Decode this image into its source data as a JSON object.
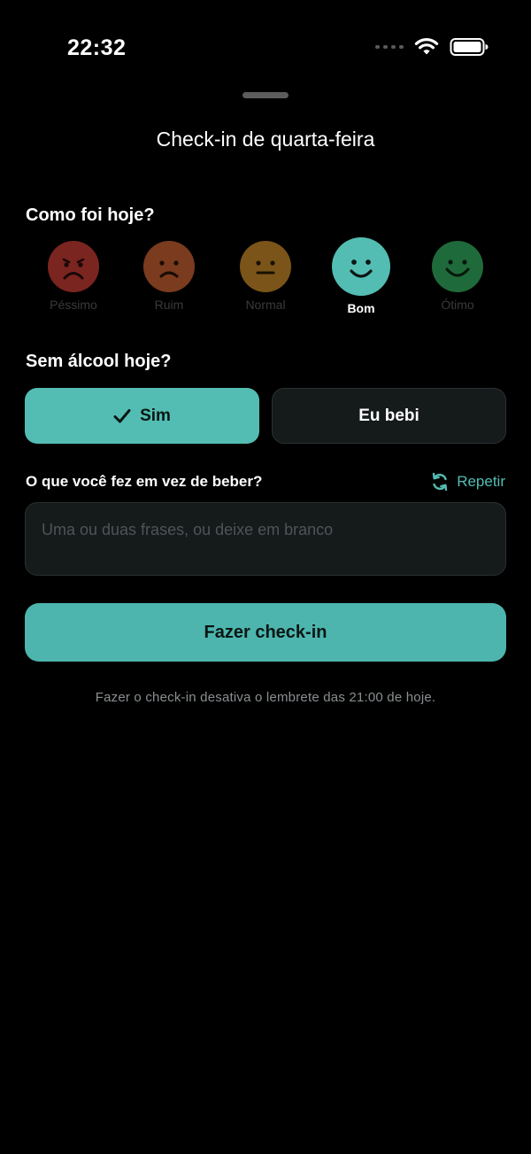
{
  "status_bar": {
    "time": "22:32"
  },
  "sheet": {
    "title": "Check-in de quarta-feira"
  },
  "mood": {
    "title": "Como foi hoje?",
    "options": [
      {
        "label": "Péssimo",
        "icon": "very-sad-face-icon",
        "color": "#7a2520",
        "selected": false
      },
      {
        "label": "Ruim",
        "icon": "sad-face-icon",
        "color": "#7a3b1f",
        "selected": false
      },
      {
        "label": "Normal",
        "icon": "neutral-face-icon",
        "color": "#7a5418",
        "selected": false
      },
      {
        "label": "Bom",
        "icon": "happy-face-icon",
        "color": "#53bdb3",
        "selected": true
      },
      {
        "label": "Ótimo",
        "icon": "very-happy-face-icon",
        "color": "#1f6a3a",
        "selected": false
      }
    ]
  },
  "alcohol": {
    "title": "Sem álcool hoje?",
    "yes_label": "Sim",
    "no_label": "Eu bebi",
    "selected": "yes"
  },
  "instead": {
    "question": "O que você fez em vez de beber?",
    "repeat_label": "Repetir",
    "placeholder": "Uma ou duas frases, ou deixe em branco",
    "value": ""
  },
  "submit_label": "Fazer check-in",
  "footnote": "Fazer o check-in desativa o lembrete das 21:00 de hoje.",
  "colors": {
    "accent": "#53bdb3",
    "background": "#000000",
    "surface": "#151a1b"
  }
}
